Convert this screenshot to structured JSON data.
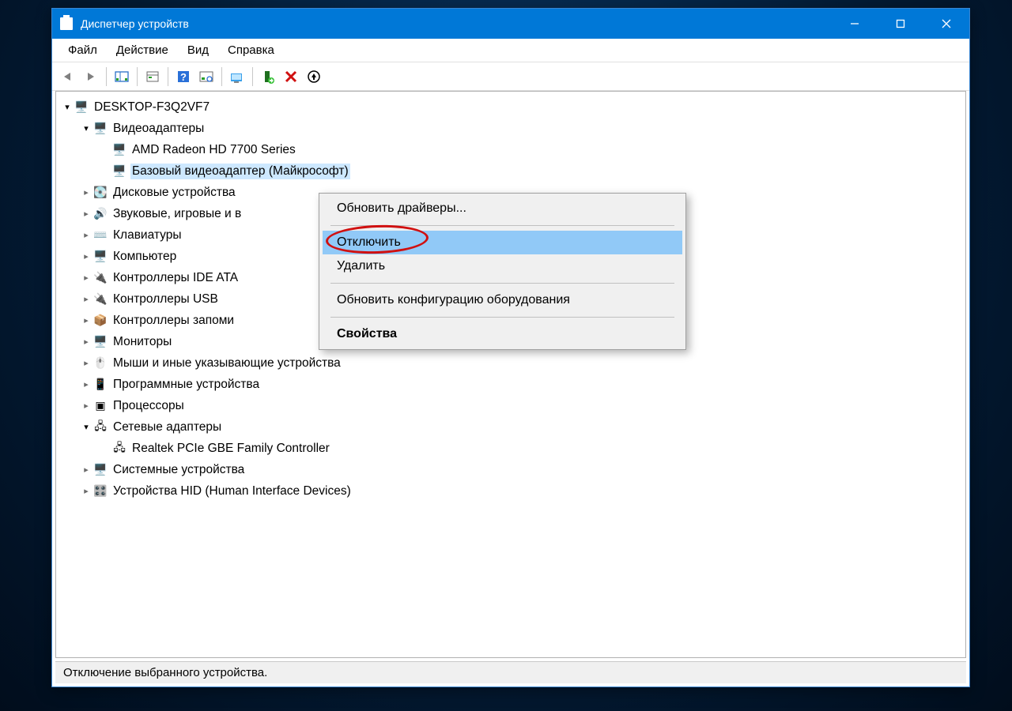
{
  "window": {
    "title": "Диспетчер устройств"
  },
  "menubar": {
    "file": "Файл",
    "action": "Действие",
    "view": "Вид",
    "help": "Справка"
  },
  "tree": {
    "root": "DESKTOP-F3Q2VF7",
    "video_adapters": "Видеоадаптеры",
    "amd": "AMD Radeon HD 7700 Series",
    "ms_basic": "Базовый видеоадаптер (Майкрософт)",
    "disk": "Дисковые устройства",
    "sound": "Звуковые, игровые и в",
    "keyboards": "Клавиатуры",
    "computer": "Компьютер",
    "ide": "Контроллеры IDE ATA",
    "usb": "Контроллеры USB",
    "storage_ctrl": "Контроллеры запоми",
    "monitors": "Мониторы",
    "mice": "Мыши и иные указывающие устройства",
    "software_dev": "Программные устройства",
    "processors": "Процессоры",
    "net_adapters": "Сетевые адаптеры",
    "realtek": "Realtek PCIe GBE Family Controller",
    "system_dev": "Системные устройства",
    "hid": "Устройства HID (Human Interface Devices)"
  },
  "context_menu": {
    "update": "Обновить драйверы...",
    "disable": "Отключить",
    "uninstall": "Удалить",
    "scan": "Обновить конфигурацию оборудования",
    "properties": "Свойства"
  },
  "statusbar": {
    "text": "Отключение выбранного устройства."
  }
}
